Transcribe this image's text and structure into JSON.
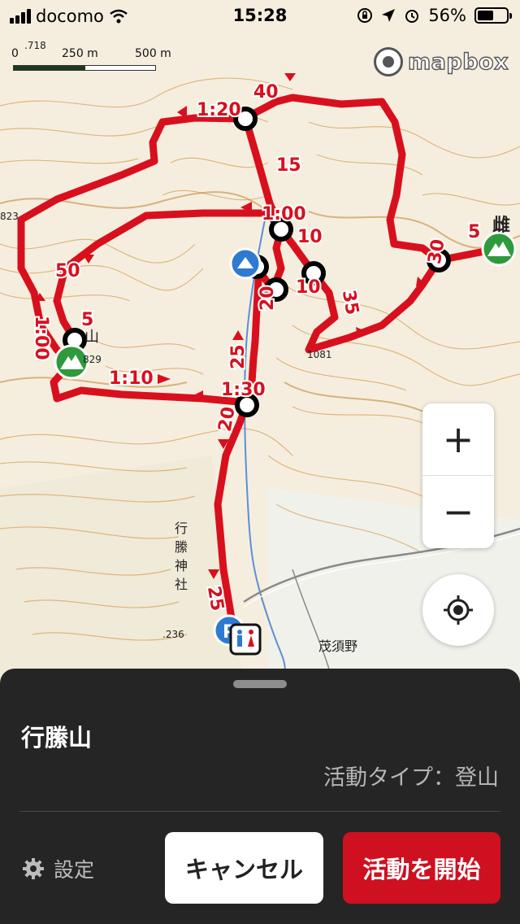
{
  "status_bar": {
    "carrier": "docomo",
    "time": "15:28",
    "battery": "56%",
    "battery_level": 0.56
  },
  "map": {
    "scale_labels": [
      "0",
      "250 m",
      "500 m"
    ],
    "provider": "mapbox",
    "route_times": [
      "40",
      "1:20",
      "15",
      "1:00",
      "10",
      "10",
      "35",
      "30",
      "5",
      "50",
      "1:00",
      "5",
      "1:10",
      "1:30",
      "25",
      "20",
      "20",
      "25"
    ],
    "place_labels": [
      "行縢神社",
      "茂須野",
      "雌",
      "山"
    ],
    "elevations": [
      "718",
      "823",
      "236",
      "1081",
      "829"
    ],
    "colors": {
      "route": "#d8101e",
      "peak": "#2e9a3c",
      "parking": "#2f7ad1"
    }
  },
  "controls": {
    "zoom_in": "+",
    "zoom_out": "−",
    "locate_icon": "crosshair-icon"
  },
  "sheet": {
    "title": "行縢山",
    "activity_type": "活動タイプ：登山",
    "settings_label": "設定",
    "cancel_label": "キャンセル",
    "start_label": "活動を開始"
  }
}
